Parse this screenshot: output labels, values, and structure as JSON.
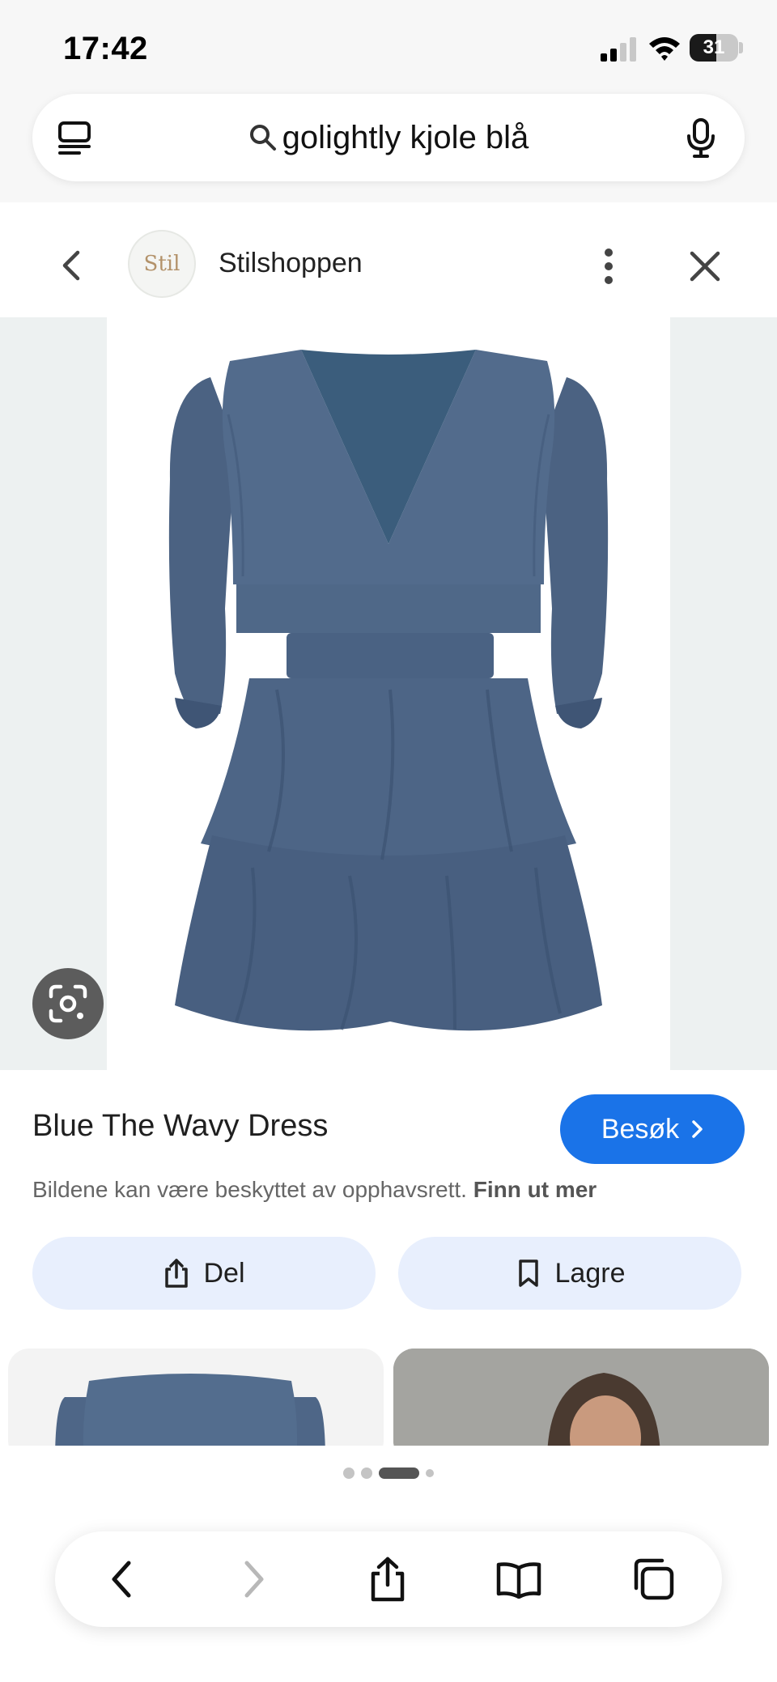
{
  "status_bar": {
    "time": "17:42",
    "battery": "31"
  },
  "search": {
    "query": "golightly kjole blå"
  },
  "source": {
    "logo_text": "Stil",
    "site_name": "Stilshoppen"
  },
  "product": {
    "title": "Blue The Wavy Dress",
    "visit_label": "Besøk",
    "copyright_text": "Bildene kan være beskyttet av opphavsrett.",
    "learn_more": "Finn ut mer",
    "share_label": "Del",
    "save_label": "Lagre"
  },
  "pager": {
    "total": 4,
    "active_index": 2
  },
  "colors": {
    "accent": "#1a73e8",
    "action_bg": "#e8effd",
    "dress": "#4f6686"
  },
  "icons": {
    "tabs": "tabs-icon",
    "search": "search-icon",
    "mic": "mic-icon",
    "back": "chevron-left-icon",
    "more": "more-vert-icon",
    "close": "close-icon",
    "lens": "lens-icon",
    "share": "share-icon",
    "save": "bookmark-icon",
    "toolbar_back": "back-icon",
    "toolbar_forward": "forward-icon",
    "toolbar_share": "share-icon",
    "toolbar_bookmarks": "book-icon",
    "toolbar_tabs": "tabs-overview-icon"
  }
}
